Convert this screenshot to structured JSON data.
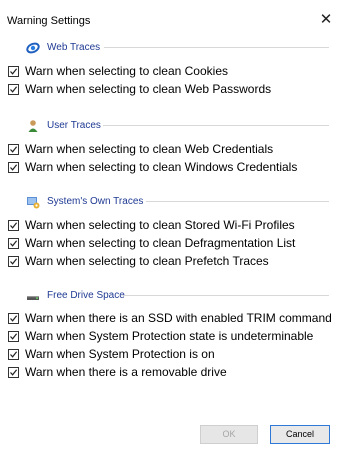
{
  "window": {
    "title": "Warning Settings",
    "close_glyph": "✕"
  },
  "sections": [
    {
      "title": "Web Traces",
      "icon": "globe-icon",
      "options": [
        {
          "label": "Warn when selecting to clean Cookies",
          "checked": true
        },
        {
          "label": "Warn when selecting to clean Web Passwords",
          "checked": true
        }
      ]
    },
    {
      "title": "User Traces",
      "icon": "user-icon",
      "options": [
        {
          "label": "Warn when selecting to clean Web Credentials",
          "checked": true
        },
        {
          "label": "Warn when selecting to clean Windows Credentials",
          "checked": true
        }
      ]
    },
    {
      "title": "System's Own Traces",
      "icon": "system-icon",
      "options": [
        {
          "label": "Warn when selecting to clean Stored Wi-Fi Profiles",
          "checked": true
        },
        {
          "label": "Warn when selecting to clean Defragmentation List",
          "checked": true
        },
        {
          "label": "Warn when selecting to clean Prefetch Traces",
          "checked": true
        }
      ]
    },
    {
      "title": "Free Drive Space",
      "icon": "drive-icon",
      "options": [
        {
          "label": "Warn when there is an SSD with enabled TRIM command",
          "checked": true
        },
        {
          "label": "Warn when System Protection state is undeterminable",
          "checked": true
        },
        {
          "label": "Warn when System Protection is on",
          "checked": true
        },
        {
          "label": "Warn when there is a removable drive",
          "checked": true
        }
      ]
    }
  ],
  "buttons": {
    "ok": "OK",
    "cancel": "Cancel"
  },
  "colors": {
    "section_title": "#1f3a93",
    "default_button_border": "#2f79d6"
  }
}
